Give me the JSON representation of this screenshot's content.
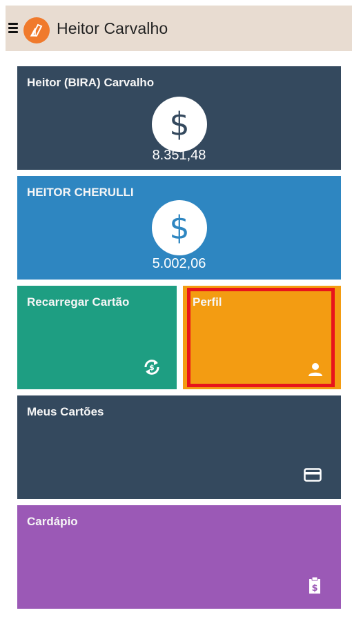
{
  "header": {
    "title": "Heitor Carvalho",
    "menu_icon": "hamburger-menu-icon",
    "logo_icon": "app-logo-icon"
  },
  "tiles": [
    {
      "id": "card-1",
      "title": "Heitor (BIRA) Carvalho",
      "balance": "8.351,48",
      "icon": "dollar-sign-icon",
      "color": "#34495e"
    },
    {
      "id": "card-2",
      "title": "HEITOR CHERULLI",
      "balance": "5.002,06",
      "icon": "dollar-sign-icon",
      "color": "#2e86c1"
    },
    {
      "id": "recharge",
      "title": "Recarregar Cartão",
      "icon": "recharge-icon",
      "color": "#1e9e82"
    },
    {
      "id": "profile",
      "title": "Perfil",
      "icon": "user-icon",
      "color": "#f39c12",
      "highlighted": true,
      "highlight_color": "#e8141b"
    },
    {
      "id": "my-cards",
      "title": "Meus Cartões",
      "icon": "credit-card-icon",
      "color": "#34495e"
    },
    {
      "id": "menu",
      "title": "Cardápio",
      "icon": "menu-clipboard-icon",
      "color": "#9b59b6"
    }
  ],
  "symbols": {
    "currency": "$"
  }
}
